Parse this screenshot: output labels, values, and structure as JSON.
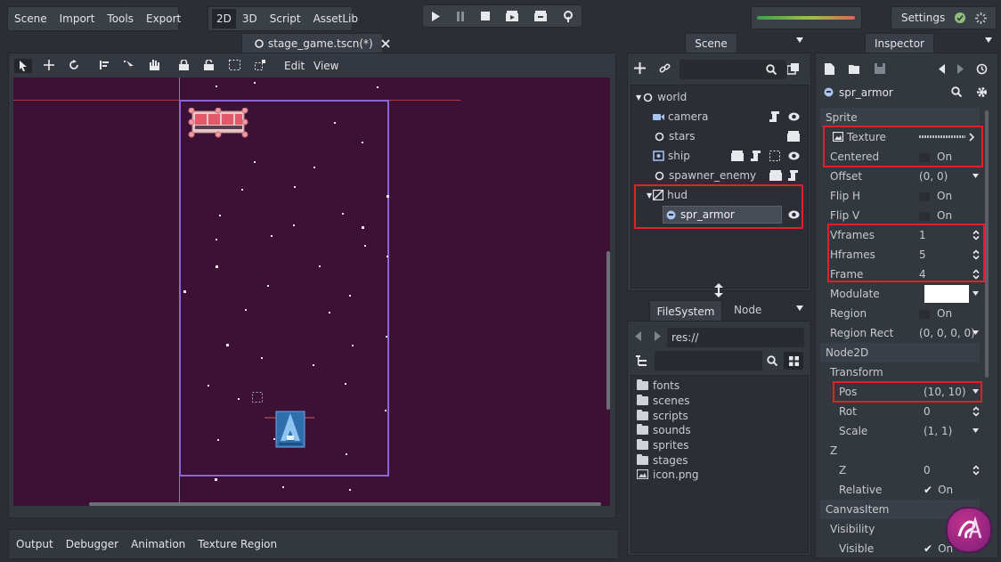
{
  "menu": {
    "scene": "Scene",
    "import": "Import",
    "tools": "Tools",
    "export": "Export"
  },
  "modes": {
    "two_d": "2D",
    "three_d": "3D",
    "script": "Script",
    "assetlib": "AssetLib"
  },
  "settings": {
    "label": "Settings"
  },
  "scene_tab": {
    "title": "stage_game.tscn(*)"
  },
  "viewport_toolbar": {
    "edit": "Edit",
    "view": "View"
  },
  "scene_dock": {
    "title": "Scene",
    "nodes": [
      {
        "name": "world",
        "icon": "node-circle-icon"
      },
      {
        "name": "camera",
        "icon": "camera-icon"
      },
      {
        "name": "stars",
        "icon": "node-circle-icon"
      },
      {
        "name": "ship",
        "icon": "sprite-icon"
      },
      {
        "name": "spawner_enemy",
        "icon": "node-circle-icon"
      },
      {
        "name": "hud",
        "icon": "canvas-layer-icon"
      },
      {
        "name": "spr_armor",
        "icon": "sprite-icon"
      }
    ]
  },
  "filesystem": {
    "tab": "FileSystem",
    "node_tab": "Node",
    "path": "res://",
    "items": [
      "fonts",
      "scenes",
      "scripts",
      "sounds",
      "sprites",
      "stages",
      "icon.png"
    ]
  },
  "inspector": {
    "title": "Inspector",
    "node_name": "spr_armor",
    "sections": {
      "sprite": "Sprite",
      "node2d": "Node2D",
      "transform": "Transform",
      "z": "Z",
      "canvasitem": "CanvasItem",
      "visibility": "Visibility"
    },
    "props": {
      "texture": {
        "label": "Texture"
      },
      "centered": {
        "label": "Centered",
        "value": "On"
      },
      "offset": {
        "label": "Offset",
        "value": "(0, 0)"
      },
      "flip_h": {
        "label": "Flip H",
        "value": "On"
      },
      "flip_v": {
        "label": "Flip V",
        "value": "On"
      },
      "vframes": {
        "label": "Vframes",
        "value": "1"
      },
      "hframes": {
        "label": "Hframes",
        "value": "5"
      },
      "frame": {
        "label": "Frame",
        "value": "4"
      },
      "modulate": {
        "label": "Modulate",
        "color": "#ffffff"
      },
      "region": {
        "label": "Region",
        "value": "On"
      },
      "region_rect": {
        "label": "Region Rect",
        "value": "(0, 0, 0, 0)"
      },
      "pos": {
        "label": "Pos",
        "value": "(10, 10)"
      },
      "rot": {
        "label": "Rot",
        "value": "0"
      },
      "scale": {
        "label": "Scale",
        "value": "(1, 1)"
      },
      "z": {
        "label": "Z",
        "value": "0"
      },
      "relative": {
        "label": "Relative",
        "value": "On"
      },
      "visible": {
        "label": "Visible",
        "value": "On"
      }
    }
  },
  "bottom_panel": {
    "output": "Output",
    "debugger": "Debugger",
    "animation": "Animation",
    "texture_region": "Texture Region"
  },
  "colors": {
    "viewport_bg": "#3d1136",
    "accent_purple": "#8c66d8",
    "highlight_red": "#e0202a"
  }
}
